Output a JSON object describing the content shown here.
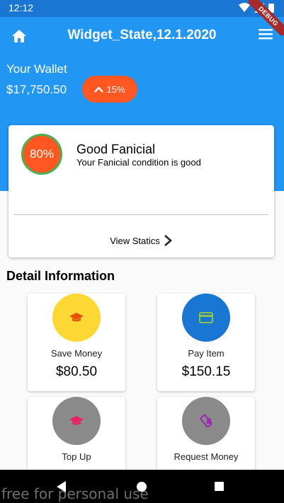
{
  "status_bar": {
    "time": "12:12",
    "ribbon": "DEBUG"
  },
  "app_bar": {
    "title": "Widget_State,12.1.2020"
  },
  "wallet": {
    "label": "Your Wallet",
    "amount": "$17,750.50",
    "change": "15%"
  },
  "summary_card": {
    "score": "80%",
    "title": "Good Fanicial",
    "subtitle": "Your Fanicial condition is good",
    "link_label": "View Statics"
  },
  "details": {
    "heading": "Detail Information",
    "tiles": [
      {
        "label": "Save Money",
        "value": "$80.50",
        "icon": "graduation-cap-icon",
        "circle_color": "#fdd835",
        "icon_color": "#e65100"
      },
      {
        "label": "Pay Item",
        "value": "$150.15",
        "icon": "credit-card-icon",
        "circle_color": "#1976d2",
        "icon_color": "#8bc34a"
      },
      {
        "label": "Top Up",
        "value": "",
        "icon": "graduation-cap-icon",
        "circle_color": "#8a8a8a",
        "icon_color": "#e91e63"
      },
      {
        "label": "Request Money",
        "value": "",
        "icon": "phone-lock-icon",
        "circle_color": "#8a8a8a",
        "icon_color": "#9c27b0"
      }
    ]
  },
  "watermark": "free for personal use",
  "colors": {
    "primary": "#2196f3",
    "accent": "#ff5722",
    "success": "#4caf50"
  }
}
